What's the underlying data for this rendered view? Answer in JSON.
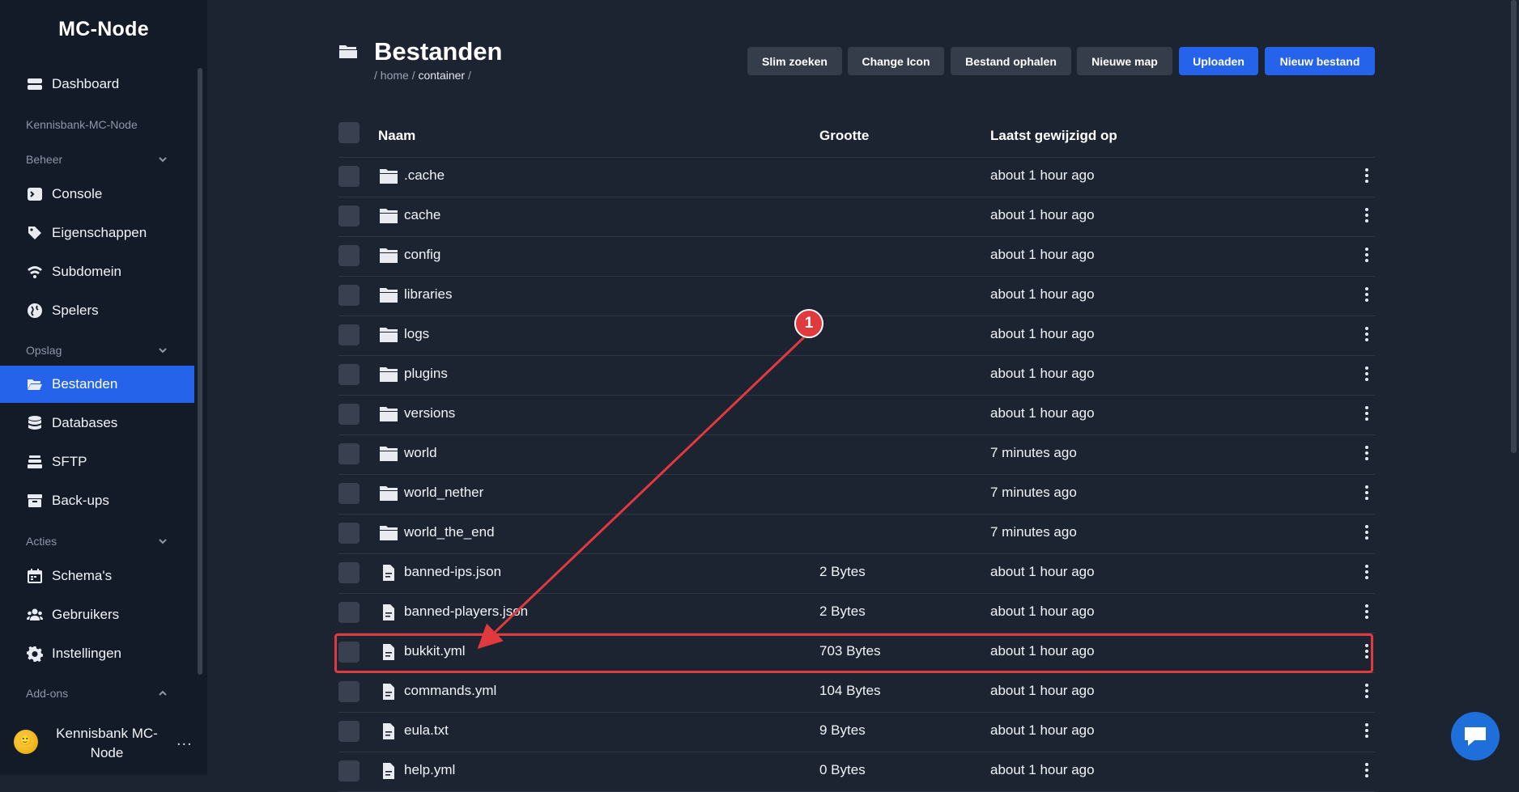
{
  "sidebar": {
    "brand": "MC-Node",
    "dashboard": "Dashboard",
    "server_name": "Kennisbank-MC-Node",
    "section_beheer": "Beheer",
    "console": "Console",
    "eigenschappen": "Eigenschappen",
    "subdomein": "Subdomein",
    "spelers": "Spelers",
    "section_opslag": "Opslag",
    "bestanden": "Bestanden",
    "databases": "Databases",
    "sftp": "SFTP",
    "backups": "Back-ups",
    "section_acties": "Acties",
    "schemas": "Schema's",
    "gebruikers": "Gebruikers",
    "instellingen": "Instellingen",
    "section_addons": "Add-ons",
    "user_name": "Kennisbank MC-Node",
    "user_more": "...",
    "avatar_emoji": "🙂"
  },
  "page": {
    "title": "Bestanden",
    "breadcrumb_root": "/ home /",
    "breadcrumb_current": "container",
    "breadcrumb_tail": "/"
  },
  "toolbar": {
    "smart_search": "Slim zoeken",
    "change_icon": "Change Icon",
    "fetch_file": "Bestand ophalen",
    "new_folder": "Nieuwe map",
    "upload": "Uploaden",
    "new_file": "Nieuw bestand"
  },
  "table": {
    "col_name": "Naam",
    "col_size": "Grootte",
    "col_modified": "Laatst gewijzigd op",
    "rows": [
      {
        "name": ".cache",
        "type": "folder",
        "size": "",
        "modified": "about 1 hour ago"
      },
      {
        "name": "cache",
        "type": "folder",
        "size": "",
        "modified": "about 1 hour ago"
      },
      {
        "name": "config",
        "type": "folder",
        "size": "",
        "modified": "about 1 hour ago"
      },
      {
        "name": "libraries",
        "type": "folder",
        "size": "",
        "modified": "about 1 hour ago"
      },
      {
        "name": "logs",
        "type": "folder",
        "size": "",
        "modified": "about 1 hour ago"
      },
      {
        "name": "plugins",
        "type": "folder",
        "size": "",
        "modified": "about 1 hour ago"
      },
      {
        "name": "versions",
        "type": "folder",
        "size": "",
        "modified": "about 1 hour ago"
      },
      {
        "name": "world",
        "type": "folder",
        "size": "",
        "modified": "7 minutes ago"
      },
      {
        "name": "world_nether",
        "type": "folder",
        "size": "",
        "modified": "7 minutes ago"
      },
      {
        "name": "world_the_end",
        "type": "folder",
        "size": "",
        "modified": "7 minutes ago"
      },
      {
        "name": "banned-ips.json",
        "type": "file",
        "size": "2 Bytes",
        "modified": "about 1 hour ago"
      },
      {
        "name": "banned-players.json",
        "type": "file",
        "size": "2 Bytes",
        "modified": "about 1 hour ago"
      },
      {
        "name": "bukkit.yml",
        "type": "file",
        "size": "703 Bytes",
        "modified": "about 1 hour ago"
      },
      {
        "name": "commands.yml",
        "type": "file",
        "size": "104 Bytes",
        "modified": "about 1 hour ago"
      },
      {
        "name": "eula.txt",
        "type": "file",
        "size": "9 Bytes",
        "modified": "about 1 hour ago"
      },
      {
        "name": "help.yml",
        "type": "file",
        "size": "0 Bytes",
        "modified": "about 1 hour ago"
      }
    ]
  },
  "annotation": {
    "badge_number": "1",
    "color": "#e0393e"
  },
  "colors": {
    "accent": "#2563eb",
    "background": "#1c2331",
    "sidebar": "#131a28",
    "highlight": "#e0393e"
  }
}
